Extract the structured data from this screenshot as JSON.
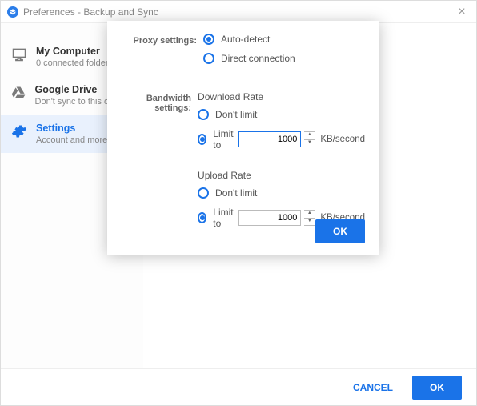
{
  "window": {
    "title": "Preferences - Backup and Sync"
  },
  "sidebar": {
    "items": [
      {
        "title": "My Computer",
        "sub": "0 connected folders"
      },
      {
        "title": "Google Drive",
        "sub": "Don't sync to this computer"
      },
      {
        "title": "Settings",
        "sub": "Account and more"
      }
    ]
  },
  "dialog": {
    "proxy": {
      "label": "Proxy settings:",
      "option_auto": "Auto-detect",
      "option_direct": "Direct connection"
    },
    "bandwidth": {
      "label": "Bandwidth settings:",
      "download": {
        "title": "Download Rate",
        "dont_limit": "Don't limit",
        "limit_to": "Limit to",
        "value": "1000",
        "unit": "KB/second"
      },
      "upload": {
        "title": "Upload Rate",
        "dont_limit": "Don't limit",
        "limit_to": "Limit to",
        "value": "1000",
        "unit": "KB/second"
      }
    },
    "ok": "OK"
  },
  "footer": {
    "cancel": "CANCEL",
    "ok": "OK"
  }
}
